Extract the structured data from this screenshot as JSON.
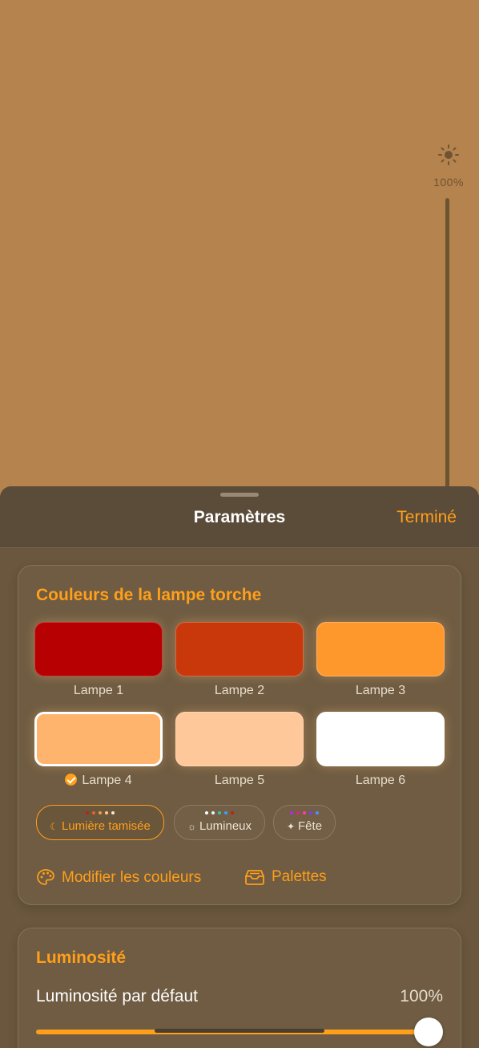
{
  "background": {
    "color": "#b5834d"
  },
  "brightness_indicator": {
    "icon": "sun-icon",
    "value": "100%"
  },
  "sheet": {
    "title": "Paramètres",
    "done_label": "Terminé",
    "accent": "#ff9f1a"
  },
  "colors_section": {
    "title": "Couleurs de la lampe torche",
    "swatches": [
      {
        "label": "Lampe 1",
        "color": "#b60001",
        "selected": false
      },
      {
        "label": "Lampe 2",
        "color": "#c9380a",
        "selected": false
      },
      {
        "label": "Lampe 3",
        "color": "#ff982c",
        "selected": false
      },
      {
        "label": "Lampe 4",
        "color": "#ffb46e",
        "selected": true
      },
      {
        "label": "Lampe 5",
        "color": "#ffc89a",
        "selected": false
      },
      {
        "label": "Lampe 6",
        "color": "#ffffff",
        "selected": false
      }
    ],
    "palettes": [
      {
        "label": "Lumière tamisée",
        "icon": "moon-icon",
        "active": true,
        "dots": [
          "#c0201a",
          "#e8622a",
          "#f59a3e",
          "#ffc88a",
          "#ffe6c8"
        ]
      },
      {
        "label": "Lumineux",
        "icon": "bulb-icon",
        "active": false,
        "dots": [
          "#ffffff",
          "#e8f4ff",
          "#2ec4b6",
          "#3aa0ff",
          "#c0201a"
        ]
      },
      {
        "label": "Fête",
        "icon": "party-icon",
        "active": false,
        "dots": [
          "#b026ff",
          "#e0218a",
          "#ff3fa4",
          "#7a3cff",
          "#5a8cff"
        ]
      }
    ],
    "edit_colors_label": "Modifier les couleurs",
    "palettes_label": "Palettes"
  },
  "brightness_section": {
    "title": "Luminosité",
    "default_label": "Luminosité par défaut",
    "default_value": "100%",
    "slider_level": 1.0
  }
}
